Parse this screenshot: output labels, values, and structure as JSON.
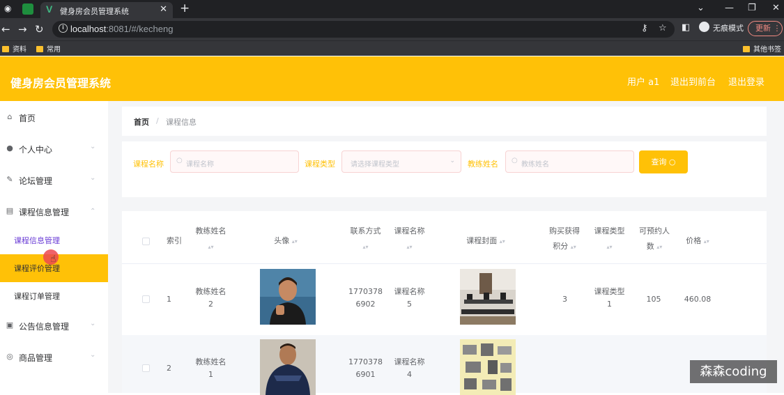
{
  "browser": {
    "tab_title": "健身房会员管理系统",
    "url_host": "localhost",
    "url_rest": ":8081/#/kecheng",
    "incognito_label": "无痕模式",
    "update_label": "更新",
    "bookmarks": [
      "资料",
      "常用"
    ],
    "other_bookmarks": "其他书签"
  },
  "header": {
    "title": "健身房会员管理系统",
    "user": "用户 a1",
    "back_to_front": "退出到前台",
    "logout": "退出登录"
  },
  "sidebar": {
    "items": [
      {
        "label": "首页",
        "icon": "home-icon"
      },
      {
        "label": "个人中心",
        "icon": "user-icon"
      },
      {
        "label": "论坛管理",
        "icon": "forum-icon"
      },
      {
        "label": "课程信息管理",
        "icon": "chart-icon"
      },
      {
        "label": "公告信息管理",
        "icon": "notice-icon"
      },
      {
        "label": "商品管理",
        "icon": "goods-icon"
      }
    ],
    "submenu": [
      "课程信息管理",
      "课程评价管理",
      "课程订单管理"
    ]
  },
  "breadcrumb": {
    "home": "首页",
    "sep": "/",
    "current": "课程信息"
  },
  "search": {
    "course_name_label": "课程名称",
    "course_name_placeholder": "课程名称",
    "course_type_label": "课程类型",
    "course_type_placeholder": "请选择课程类型",
    "coach_label": "教练姓名",
    "coach_placeholder": "教练姓名",
    "query_label": "查询"
  },
  "table": {
    "headers": {
      "index": "索引",
      "coach_1": "教练姓名",
      "avatar": "头像",
      "phone": "联系方式",
      "course_name": "课程名称",
      "cover": "课程封面",
      "points_1": "购买获得",
      "points_2": "积分",
      "course_type": "课程类型",
      "capacity_1": "可预约人",
      "capacity_2": "数",
      "price": "价格"
    },
    "rows": [
      {
        "index": "1",
        "coach_1": "教练姓名",
        "coach_2": "2",
        "phone_1": "1770378",
        "phone_2": "6902",
        "course_1": "课程名称",
        "course_2": "5",
        "points": "3",
        "type_1": "课程类型",
        "type_2": "1",
        "capacity": "105",
        "price": "460.08"
      },
      {
        "index": "2",
        "coach_1": "教练姓名",
        "coach_2": "1",
        "phone_1": "1770378",
        "phone_2": "6901",
        "course_1": "课程名称",
        "course_2": "4"
      }
    ]
  },
  "watermark": "森森coding"
}
